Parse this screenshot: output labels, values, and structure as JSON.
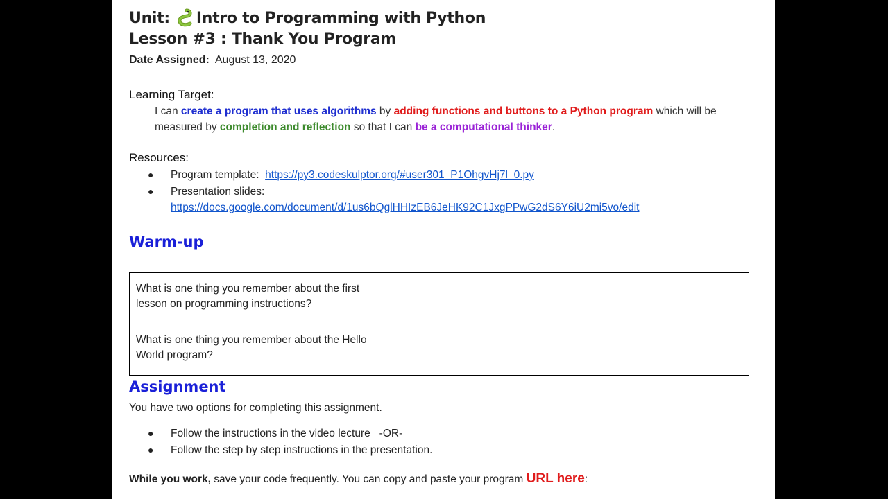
{
  "document": {
    "unit_prefix": "Unit:",
    "unit_title": "Intro to Programming with Python",
    "lesson_title": "Lesson #3 : Thank You Program",
    "date_label": "Date Assigned:",
    "date_value": "August 13, 2020",
    "learning_target": {
      "label": "Learning Target",
      "colon": ":",
      "parts": [
        "I can ",
        "create a program that uses algorithms",
        " by ",
        "adding functions and buttons to a Python program",
        " which will be measured by ",
        "completion and reflection",
        " so that I can ",
        "be a computational thinker",
        "."
      ]
    },
    "resources": {
      "label": "Resources",
      "colon": ":",
      "items": [
        {
          "label": "Program template:",
          "url": "https://py3.codeskulptor.org/#user301_P1OhgvHj7l_0.py"
        },
        {
          "label": "Presentation slides:",
          "url": "https://docs.google.com/document/d/1us6bQglHHIzEB6JeHK92C1JxgPPwG2dS6Y6iU2mi5vo/edit"
        }
      ]
    },
    "warmup": {
      "heading": "Warm-up",
      "rows": [
        {
          "question": "What is one thing you remember about the first lesson on programming instructions?",
          "answer": ""
        },
        {
          "question": "What is one thing you remember about the Hello World program?",
          "answer": ""
        }
      ]
    },
    "assignment": {
      "heading": "Assignment",
      "intro": "You have two options for completing this assignment.",
      "options": [
        "Follow the instructions in the video lecture   -OR-",
        "Follow the step by step instructions in the presentation."
      ],
      "work_bold": "While you work,",
      "work_text": " save your code frequently. You can copy and paste your program ",
      "url_here": "URL here",
      "work_colon": ":"
    }
  },
  "colors": {
    "heading_blue": "#1a20d8",
    "target_blue": "#1f2fd0",
    "target_red": "#e01b1b",
    "target_green": "#3c8a2c",
    "target_purple": "#9a22d6",
    "link": "#1155cc"
  },
  "icons": {
    "unit_icon": "snake-icon",
    "bullet_icon": "bullet-dot-icon"
  }
}
